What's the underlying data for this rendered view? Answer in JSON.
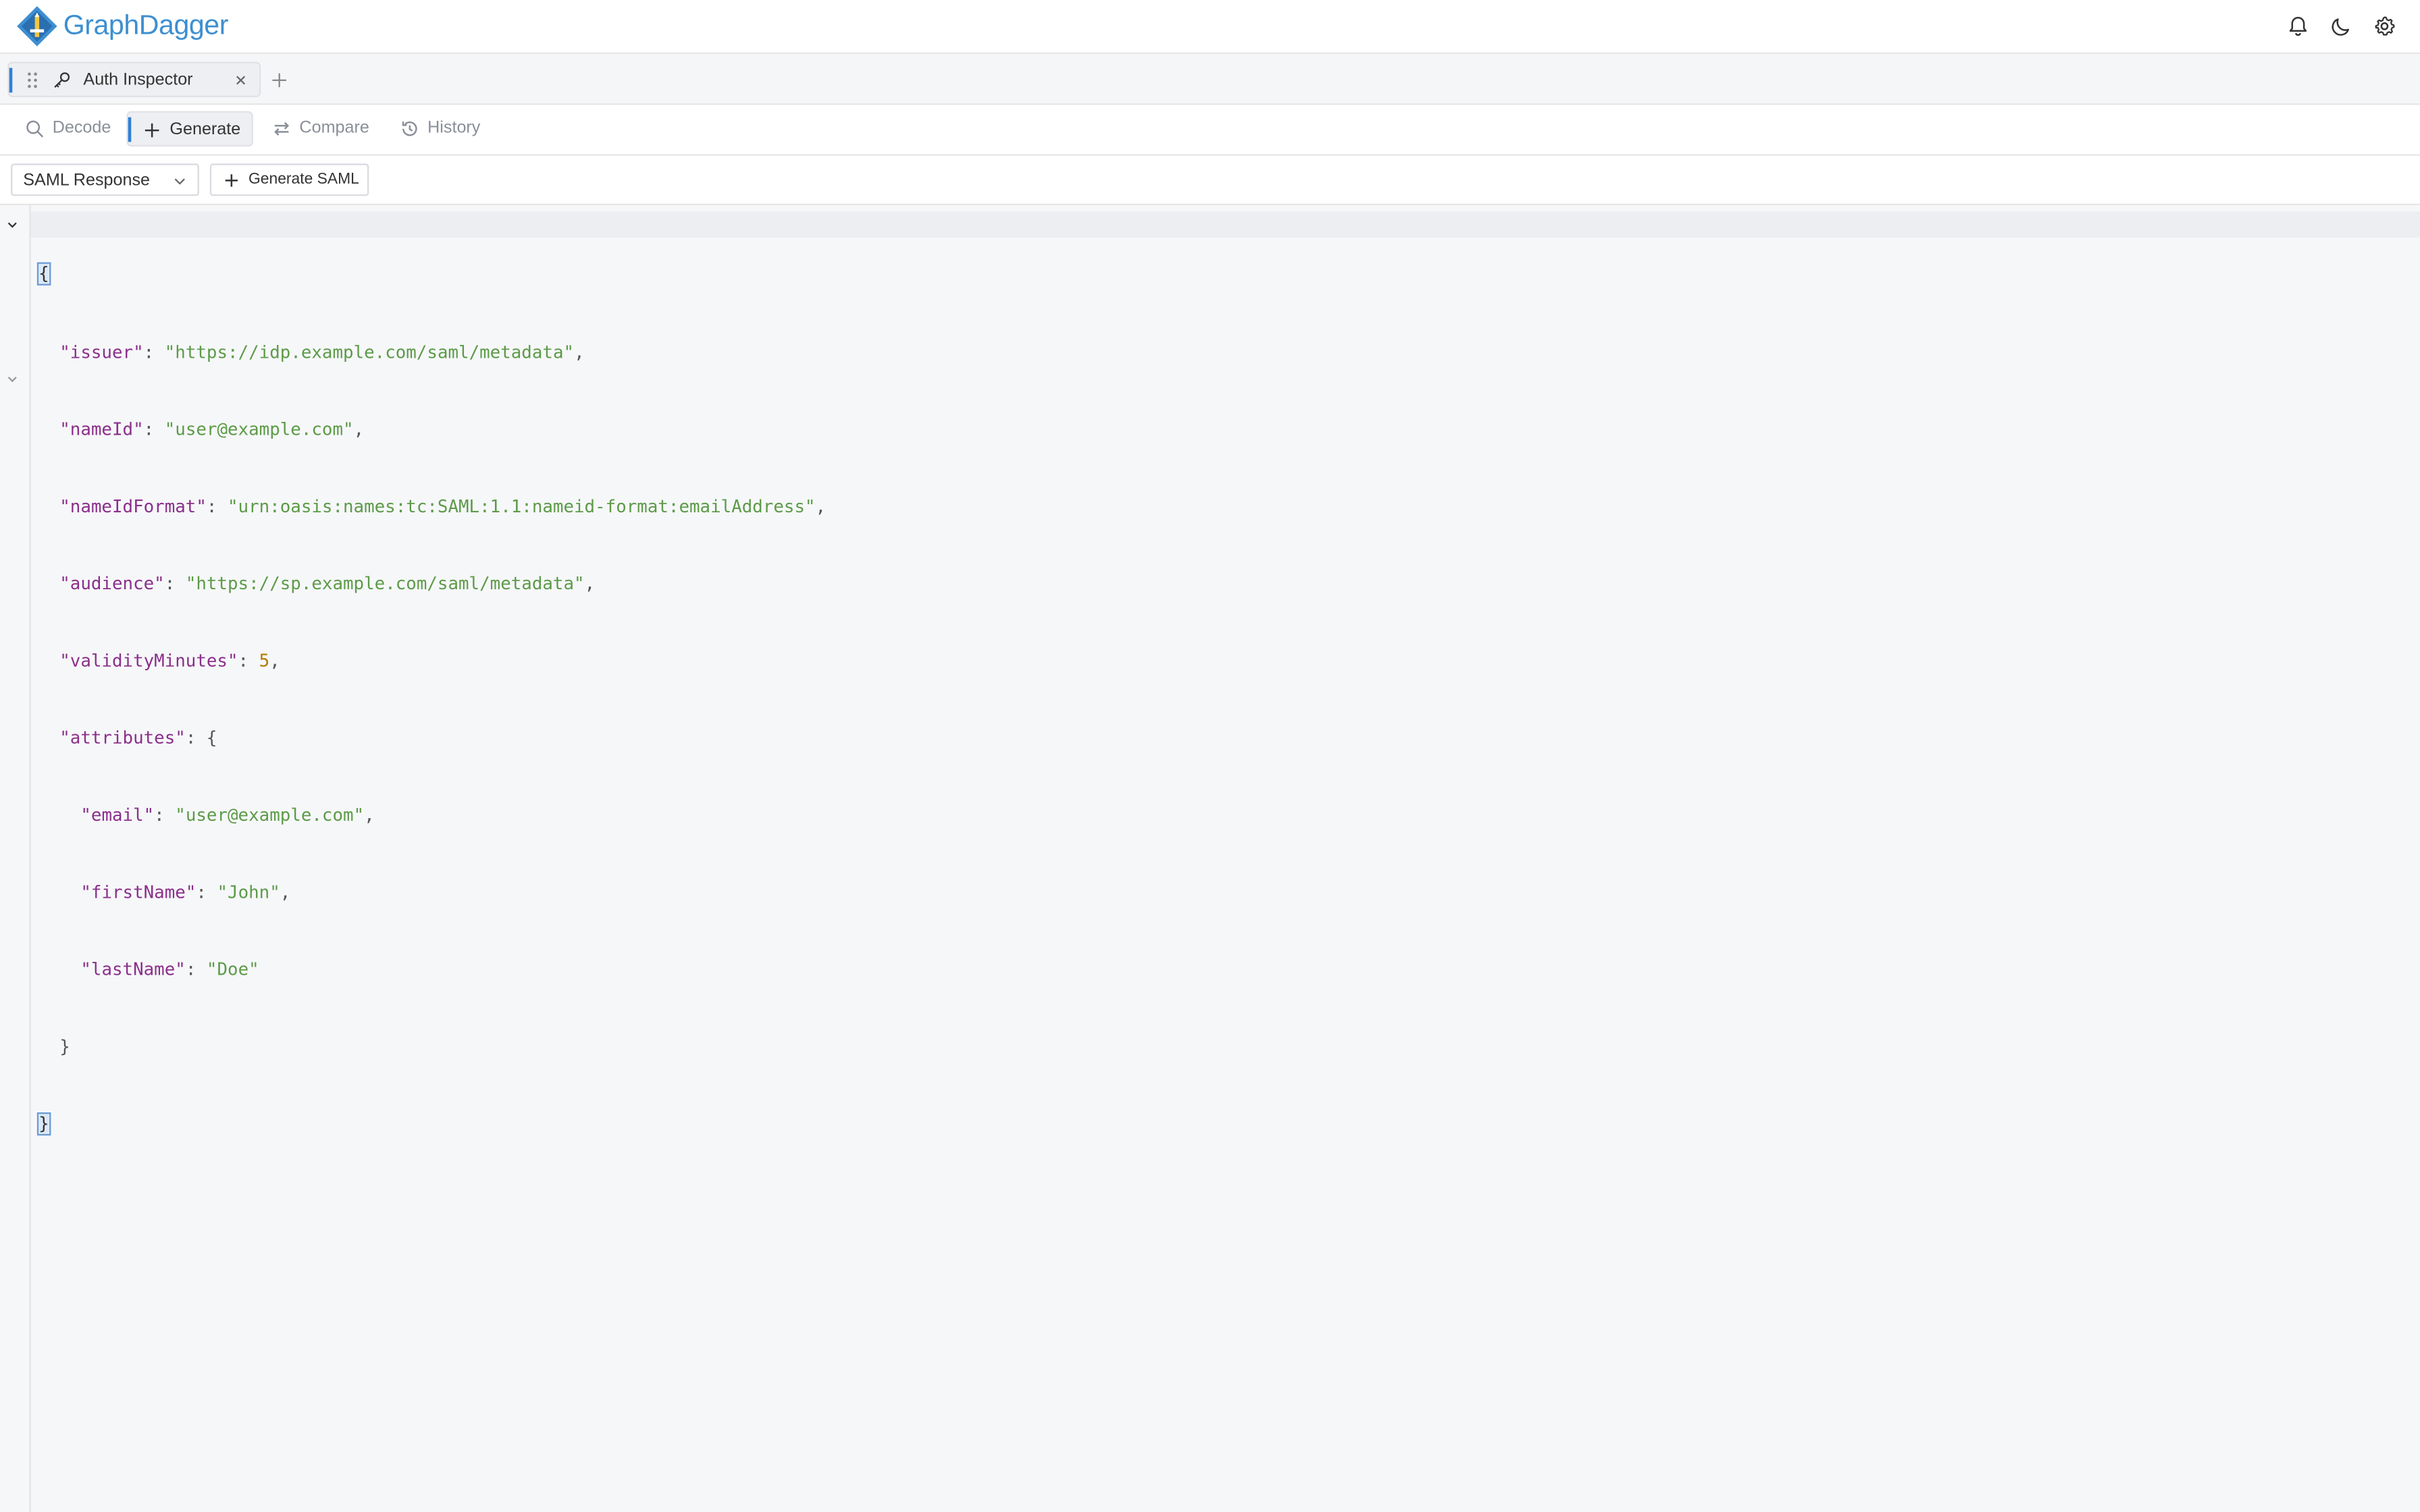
{
  "app": {
    "brand": "GraphDagger",
    "brand_color": "#3d8fd1",
    "accent_color": "#2f7fd6"
  },
  "header": {
    "icons": [
      "bell-icon",
      "moon-icon",
      "gear-icon"
    ]
  },
  "tabs": [
    {
      "label": "Auth Inspector",
      "icon": "key-icon",
      "active": true
    }
  ],
  "modes": [
    {
      "label": "Decode",
      "icon": "search-icon",
      "active": false
    },
    {
      "label": "Generate",
      "icon": "plus-icon",
      "active": true
    },
    {
      "label": "Compare",
      "icon": "swap-icon",
      "active": false
    },
    {
      "label": "History",
      "icon": "history-icon",
      "active": false
    }
  ],
  "toolbar": {
    "type_select": "SAML Response",
    "generate_label": "Generate SAML"
  },
  "editor": {
    "colors": {
      "key": "#8b2f8b",
      "string": "#5c9b48",
      "number": "#b07c00"
    },
    "open_brace": "{",
    "close_brace": "}",
    "fields": {
      "issuer": {
        "key": "\"issuer\"",
        "value": "\"https://idp.example.com/saml/metadata\""
      },
      "nameId": {
        "key": "\"nameId\"",
        "value": "\"user@example.com\""
      },
      "nameIdFormat": {
        "key": "\"nameIdFormat\"",
        "value": "\"urn:oasis:names:tc:SAML:1.1:nameid-format:emailAddress\""
      },
      "audience": {
        "key": "\"audience\"",
        "value": "\"https://sp.example.com/saml/metadata\""
      },
      "validityMinutes": {
        "key": "\"validityMinutes\"",
        "value": "5"
      },
      "attributes": {
        "key": "\"attributes\""
      },
      "email": {
        "key": "\"email\"",
        "value": "\"user@example.com\""
      },
      "firstName": {
        "key": "\"firstName\"",
        "value": "\"John\""
      },
      "lastName": {
        "key": "\"lastName\"",
        "value": "\"Doe\""
      }
    }
  }
}
